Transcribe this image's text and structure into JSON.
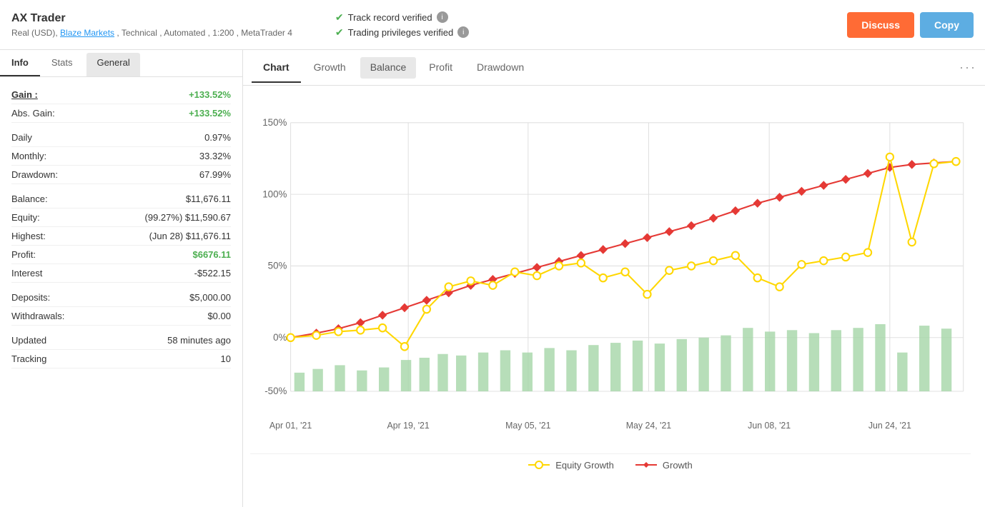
{
  "header": {
    "title": "AX Trader",
    "subtitle": "Real (USD),",
    "broker_link": "Blaze Markets",
    "subtitle_rest": ", Technical , Automated , 1:200 , MetaTrader 4",
    "verify1": "Track record verified",
    "verify2": "Trading privileges verified",
    "btn_discuss": "Discuss",
    "btn_copy": "Copy"
  },
  "left_panel": {
    "tabs": [
      {
        "label": "Info",
        "active": true
      },
      {
        "label": "Stats",
        "active": false
      },
      {
        "label": "General",
        "active": false,
        "bg": true
      }
    ],
    "stats": [
      {
        "label": "Gain :",
        "value": "+133.52%",
        "label_class": "bold underline",
        "value_class": "green"
      },
      {
        "label": "Abs. Gain:",
        "value": "+133.52%",
        "value_class": "green"
      },
      {
        "label": "spacer"
      },
      {
        "label": "Daily",
        "value": "0.97%"
      },
      {
        "label": "Monthly:",
        "value": "33.32%"
      },
      {
        "label": "Drawdown:",
        "value": "67.99%"
      },
      {
        "label": "spacer"
      },
      {
        "label": "Balance:",
        "value": "$11,676.11"
      },
      {
        "label": "Equity:",
        "value": "(99.27%) $11,590.67"
      },
      {
        "label": "Highest:",
        "value": "(Jun 28) $11,676.11"
      },
      {
        "label": "Profit:",
        "value": "$6676.11",
        "value_class": "profit-green"
      },
      {
        "label": "Interest",
        "value": "-$522.15"
      },
      {
        "label": "spacer"
      },
      {
        "label": "Deposits:",
        "value": "$5,000.00"
      },
      {
        "label": "Withdrawals:",
        "value": "$0.00"
      },
      {
        "label": "spacer"
      },
      {
        "label": "Updated",
        "value": "58 minutes ago"
      },
      {
        "label": "Tracking",
        "value": "10"
      }
    ]
  },
  "chart_panel": {
    "tabs": [
      {
        "label": "Chart",
        "active": true
      },
      {
        "label": "Growth",
        "active": false
      },
      {
        "label": "Balance",
        "active": false,
        "bg": true
      },
      {
        "label": "Profit",
        "active": false
      },
      {
        "label": "Drawdown",
        "active": false
      }
    ],
    "more_icon": "···",
    "y_labels": [
      "150%",
      "100%",
      "50%",
      "0%",
      "-50%"
    ],
    "x_labels": [
      "Apr 01, '21",
      "Apr 19, '21",
      "May 05, '21",
      "May 24, '21",
      "Jun 08, '21",
      "Jun 24, '21"
    ],
    "legend": {
      "equity_label": "Equity Growth",
      "growth_label": "Growth"
    }
  }
}
